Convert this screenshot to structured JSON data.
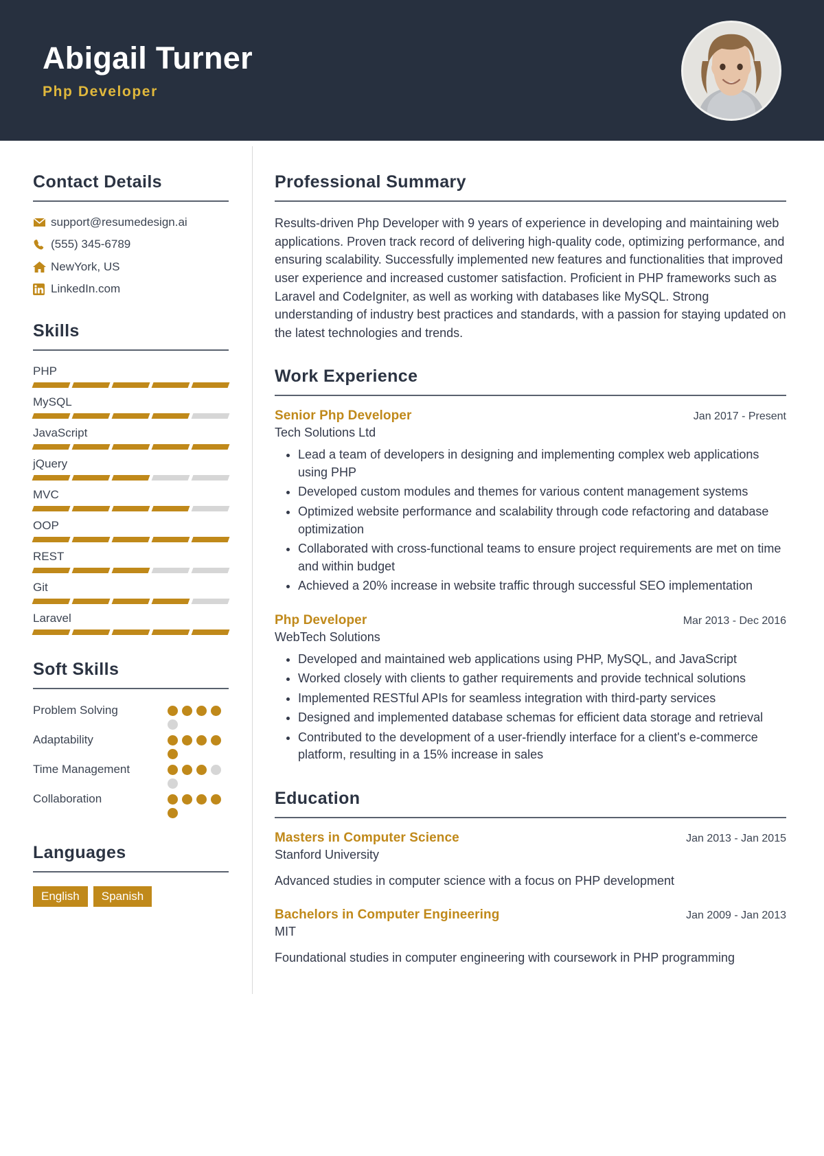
{
  "header": {
    "name": "Abigail Turner",
    "job_title": "Php Developer",
    "avatar_alt": "profile-photo",
    "bg_color": "#27303f",
    "accent_color": "#e0b83c"
  },
  "theme": {
    "gold": "#c0891a",
    "dark": "#27303f",
    "muted_bar": "#d6d6d6",
    "rule": "#59616e"
  },
  "sidebar": {
    "contact": {
      "title": "Contact Details",
      "items": [
        {
          "icon": "email-icon",
          "text": "support@resumedesign.ai"
        },
        {
          "icon": "phone-icon",
          "text": "(555) 345-6789"
        },
        {
          "icon": "home-icon",
          "text": "NewYork, US"
        },
        {
          "icon": "linkedin-icon",
          "text": "LinkedIn.com"
        }
      ]
    },
    "skills": {
      "title": "Skills",
      "max": 5,
      "items": [
        {
          "name": "PHP",
          "level": 5
        },
        {
          "name": "MySQL",
          "level": 4
        },
        {
          "name": "JavaScript",
          "level": 5
        },
        {
          "name": "jQuery",
          "level": 3
        },
        {
          "name": "MVC",
          "level": 4
        },
        {
          "name": "OOP",
          "level": 5
        },
        {
          "name": "REST",
          "level": 3
        },
        {
          "name": "Git",
          "level": 4
        },
        {
          "name": "Laravel",
          "level": 5
        }
      ]
    },
    "soft_skills": {
      "title": "Soft Skills",
      "max": 5,
      "items": [
        {
          "name": "Problem Solving",
          "level": 4
        },
        {
          "name": "Adaptability",
          "level": 5
        },
        {
          "name": "Time Management",
          "level": 3
        },
        {
          "name": "Collaboration",
          "level": 5
        }
      ]
    },
    "languages": {
      "title": "Languages",
      "items": [
        "English",
        "Spanish"
      ]
    }
  },
  "main": {
    "summary": {
      "title": "Professional Summary",
      "text": "Results-driven Php Developer with 9 years of experience in developing and maintaining web applications. Proven track record of delivering high-quality code, optimizing performance, and ensuring scalability. Successfully implemented new features and functionalities that improved user experience and increased customer satisfaction. Proficient in PHP frameworks such as Laravel and CodeIgniter, as well as working with databases like MySQL. Strong understanding of industry best practices and standards, with a passion for staying updated on the latest technologies and trends."
    },
    "work": {
      "title": "Work Experience",
      "entries": [
        {
          "title": "Senior Php Developer",
          "org": "Tech Solutions Ltd",
          "date": "Jan 2017 - Present",
          "bullets": [
            "Lead a team of developers in designing and implementing complex web applications using PHP",
            "Developed custom modules and themes for various content management systems",
            "Optimized website performance and scalability through code refactoring and database optimization",
            "Collaborated with cross-functional teams to ensure project requirements are met on time and within budget",
            "Achieved a 20% increase in website traffic through successful SEO implementation"
          ]
        },
        {
          "title": "Php Developer",
          "org": "WebTech Solutions",
          "date": "Mar 2013 - Dec 2016",
          "bullets": [
            "Developed and maintained web applications using PHP, MySQL, and JavaScript",
            "Worked closely with clients to gather requirements and provide technical solutions",
            "Implemented RESTful APIs for seamless integration with third-party services",
            "Designed and implemented database schemas for efficient data storage and retrieval",
            "Contributed to the development of a user-friendly interface for a client's e-commerce platform, resulting in a 15% increase in sales"
          ]
        }
      ]
    },
    "education": {
      "title": "Education",
      "entries": [
        {
          "title": "Masters in Computer Science",
          "org": "Stanford University",
          "date": "Jan 2013 - Jan 2015",
          "desc": "Advanced studies in computer science with a focus on PHP development"
        },
        {
          "title": "Bachelors in Computer Engineering",
          "org": "MIT",
          "date": "Jan 2009 - Jan 2013",
          "desc": "Foundational studies in computer engineering with coursework in PHP programming"
        }
      ]
    }
  }
}
